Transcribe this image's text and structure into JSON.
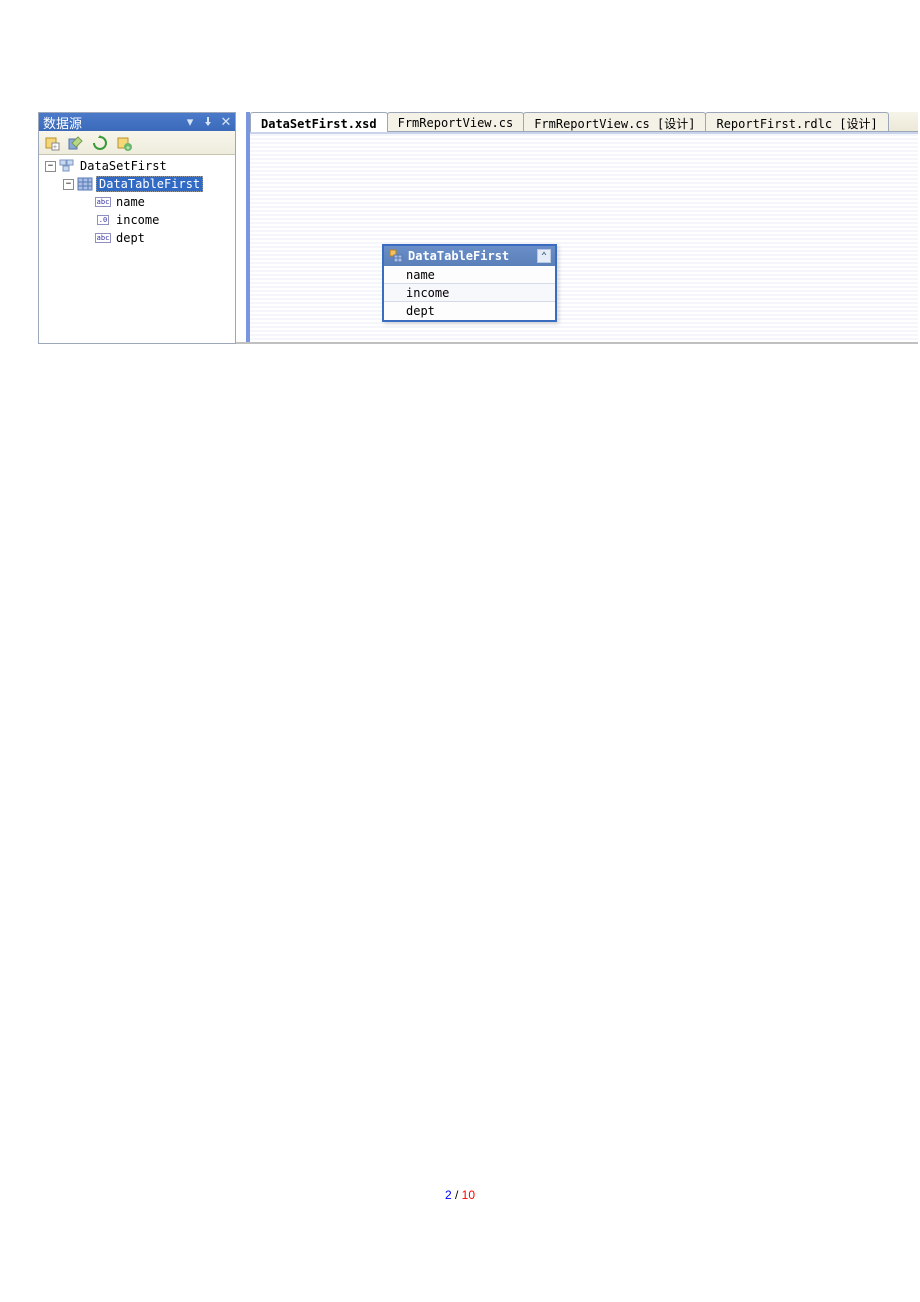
{
  "sidebar": {
    "title": "数据源",
    "tree": {
      "root": {
        "label": "DataSetFirst",
        "child": {
          "label": "DataTableFirst",
          "columns": [
            {
              "label": "name",
              "type": "abc"
            },
            {
              "label": "income",
              "type": ".0"
            },
            {
              "label": "dept",
              "type": "abc"
            }
          ]
        }
      }
    }
  },
  "tabs": [
    {
      "label": "DataSetFirst.xsd",
      "active": true
    },
    {
      "label": "FrmReportView.cs",
      "active": false
    },
    {
      "label": "FrmReportView.cs [设计]",
      "active": false
    },
    {
      "label": "ReportFirst.rdlc [设计]",
      "active": false
    }
  ],
  "datatable": {
    "title": "DataTableFirst",
    "rows": [
      "name",
      "income",
      "dept"
    ]
  },
  "footer": {
    "current": "2",
    "sep": " / ",
    "total": "10"
  }
}
